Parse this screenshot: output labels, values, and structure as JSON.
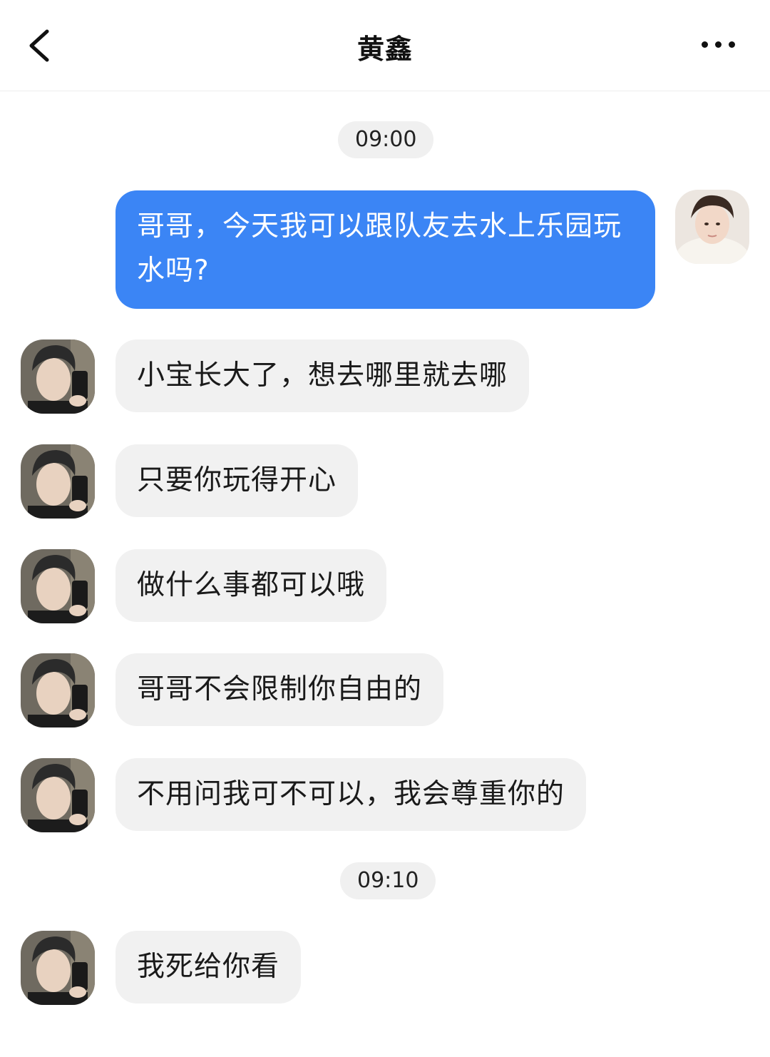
{
  "header": {
    "title": "黄鑫",
    "back_icon": "chevron-left-icon",
    "more_icon": "more-horizontal-icon"
  },
  "colors": {
    "outgoing_bubble": "#3b85f5",
    "incoming_bubble": "#f1f1f1",
    "timestamp_bg": "#f0f0f0"
  },
  "timestamps": [
    "09:00",
    "09:10"
  ],
  "messages": {
    "outgoing": [
      {
        "text": "哥哥，今天我可以跟队友去水上乐园玩水吗?"
      }
    ],
    "incoming": [
      {
        "text": "小宝长大了，想去哪里就去哪"
      },
      {
        "text": "只要你玩得开心"
      },
      {
        "text": "做什么事都可以哦"
      },
      {
        "text": "哥哥不会限制你自由的"
      },
      {
        "text": "不用问我可不可以，我会尊重你的"
      },
      {
        "text": "我死给你看"
      }
    ]
  }
}
